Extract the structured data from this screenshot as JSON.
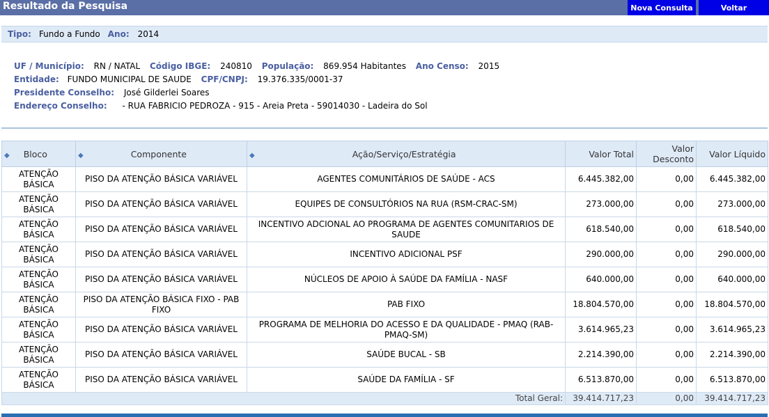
{
  "header": {
    "title": "Resultado da Pesquisa",
    "btn_nova": "Nova Consulta",
    "btn_voltar": "Voltar"
  },
  "filter": {
    "tipo_label": "Tipo:",
    "tipo_value": "Fundo a Fundo",
    "ano_label": "Ano:",
    "ano_value": "2014"
  },
  "info": {
    "uf_label": "UF / Município:",
    "uf_value": "RN / NATAL",
    "ibge_label": "Código IBGE:",
    "ibge_value": "240810",
    "pop_label": "População:",
    "pop_value": "869.954 Habitantes",
    "censo_label": "Ano Censo:",
    "censo_value": "2015",
    "entidade_label": "Entidade:",
    "entidade_value": "FUNDO MUNICIPAL DE SAUDE",
    "cnpj_label": "CPF/CNPJ:",
    "cnpj_value": "19.376.335/0001-37",
    "presidente_label": "Presidente Conselho:",
    "presidente_value": "José Gilderlei Soares",
    "endereco_label": "Endereço Conselho:",
    "endereco_value": "- RUA FABRICIO PEDROZA - 915 - Areia Preta - 59014030 - Ladeira do Sol"
  },
  "table": {
    "headers": {
      "bloco": "Bloco",
      "componente": "Componente",
      "acao": "Ação/Serviço/Estratégia",
      "valor_total": "Valor Total",
      "valor_desconto_1": "Valor",
      "valor_desconto_2": "Desconto",
      "valor_liquido": "Valor Líquido"
    },
    "rows": [
      {
        "bloco_1": "ATENÇÃO",
        "bloco_2": "BÁSICA",
        "componente": "PISO DA ATENÇÃO BÁSICA VARIÁVEL",
        "acao": "AGENTES COMUNITÁRIOS DE SAÚDE - ACS",
        "total": "6.445.382,00",
        "desconto": "0,00",
        "liquido": "6.445.382,00"
      },
      {
        "bloco_1": "ATENÇÃO",
        "bloco_2": "BÁSICA",
        "componente": "PISO DA ATENÇÃO BÁSICA VARIÁVEL",
        "acao": "EQUIPES DE CONSULTÓRIOS NA RUA (RSM-CRAC-SM)",
        "total": "273.000,00",
        "desconto": "0,00",
        "liquido": "273.000,00"
      },
      {
        "bloco_1": "ATENÇÃO",
        "bloco_2": "BÁSICA",
        "componente": "PISO DA ATENÇÃO BÁSICA VARIÁVEL",
        "acao": "INCENTIVO ADCIONAL AO PROGRAMA DE AGENTES COMUNITARIOS DE SAUDE",
        "total": "618.540,00",
        "desconto": "0,00",
        "liquido": "618.540,00"
      },
      {
        "bloco_1": "ATENÇÃO",
        "bloco_2": "BÁSICA",
        "componente": "PISO DA ATENÇÃO BÁSICA VARIÁVEL",
        "acao": "INCENTIVO ADICIONAL PSF",
        "total": "290.000,00",
        "desconto": "0,00",
        "liquido": "290.000,00"
      },
      {
        "bloco_1": "ATENÇÃO",
        "bloco_2": "BÁSICA",
        "componente": "PISO DA ATENÇÃO BÁSICA VARIÁVEL",
        "acao": "NÚCLEOS DE APOIO À SAÚDE DA FAMÍLIA - NASF",
        "total": "640.000,00",
        "desconto": "0,00",
        "liquido": "640.000,00"
      },
      {
        "bloco_1": "ATENÇÃO",
        "bloco_2": "BÁSICA",
        "componente": "PISO DA ATENÇÃO BÁSICA FIXO - PAB FIXO",
        "acao": "PAB FIXO",
        "total": "18.804.570,00",
        "desconto": "0,00",
        "liquido": "18.804.570,00"
      },
      {
        "bloco_1": "ATENÇÃO",
        "bloco_2": "BÁSICA",
        "componente": "PISO DA ATENÇÃO BÁSICA VARIÁVEL",
        "acao": "PROGRAMA DE MELHORIA DO ACESSO E DA QUALIDADE - PMAQ (RAB-PMAQ-SM)",
        "total": "3.614.965,23",
        "desconto": "0,00",
        "liquido": "3.614.965,23"
      },
      {
        "bloco_1": "ATENÇÃO",
        "bloco_2": "BÁSICA",
        "componente": "PISO DA ATENÇÃO BÁSICA VARIÁVEL",
        "acao": "SAÚDE BUCAL - SB",
        "total": "2.214.390,00",
        "desconto": "0,00",
        "liquido": "2.214.390,00"
      },
      {
        "bloco_1": "ATENÇÃO",
        "bloco_2": "BÁSICA",
        "componente": "PISO DA ATENÇÃO BÁSICA VARIÁVEL",
        "acao": "SAÚDE DA FAMÍLIA - SF",
        "total": "6.513.870,00",
        "desconto": "0,00",
        "liquido": "6.513.870,00"
      }
    ],
    "total_label": "Total Geral:",
    "total_value": "39.414.717,23",
    "total_desconto": "0,00",
    "total_liquido": "39.414.717,23"
  }
}
